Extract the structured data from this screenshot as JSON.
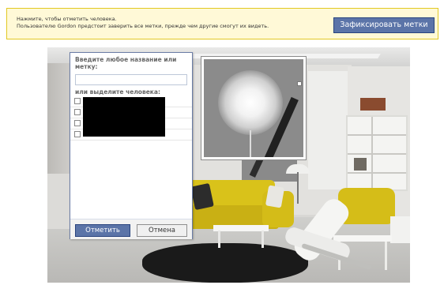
{
  "banner": {
    "line1": "Нажмите, чтобы отметить человека.",
    "line2": "Пользователю Gordon предстоит заверить все метки, прежде чем другие смогут их видеть.",
    "done_button": "Зафиксировать метки"
  },
  "tag_dialog": {
    "name_label": "Введите любое название или метку:",
    "name_value": "",
    "or_label": "или выделите человека:",
    "friends_visible": 4,
    "friends_redacted": true,
    "tag_button": "Отметить",
    "cancel_button": "Отмена"
  },
  "colors": {
    "banner_bg": "#fff9d7",
    "banner_border": "#e2c822",
    "button_blue": "#5b74a8",
    "button_border": "#29447e",
    "dialog_border": "#6b7da6"
  },
  "icons": [
    "checkbox-icon"
  ]
}
